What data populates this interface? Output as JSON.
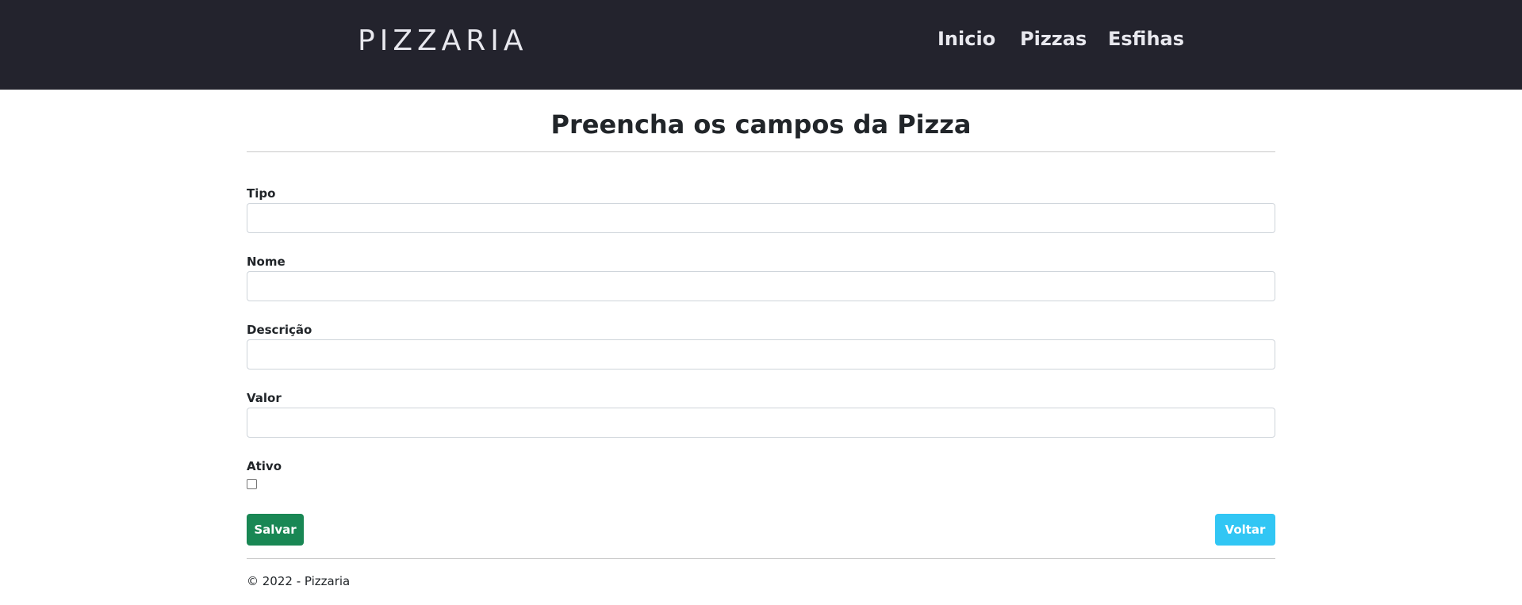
{
  "header": {
    "brand": "PIZZARIA",
    "nav": [
      {
        "label": "Inicio"
      },
      {
        "label": "Pizzas"
      },
      {
        "label": "Esfihas"
      }
    ]
  },
  "form": {
    "title": "Preencha os campos da Pizza",
    "fields": [
      {
        "label": "Tipo",
        "value": ""
      },
      {
        "label": "Nome",
        "value": ""
      },
      {
        "label": "Descrição",
        "value": ""
      },
      {
        "label": "Valor",
        "value": ""
      }
    ],
    "active_label": "Ativo",
    "active_checked": false,
    "save_label": "Salvar",
    "back_label": "Voltar"
  },
  "footer": {
    "text": "© 2022 - Pizzaria"
  },
  "colors": {
    "navbar": "#23232d",
    "save": "#198754",
    "back": "#31c6f4"
  }
}
